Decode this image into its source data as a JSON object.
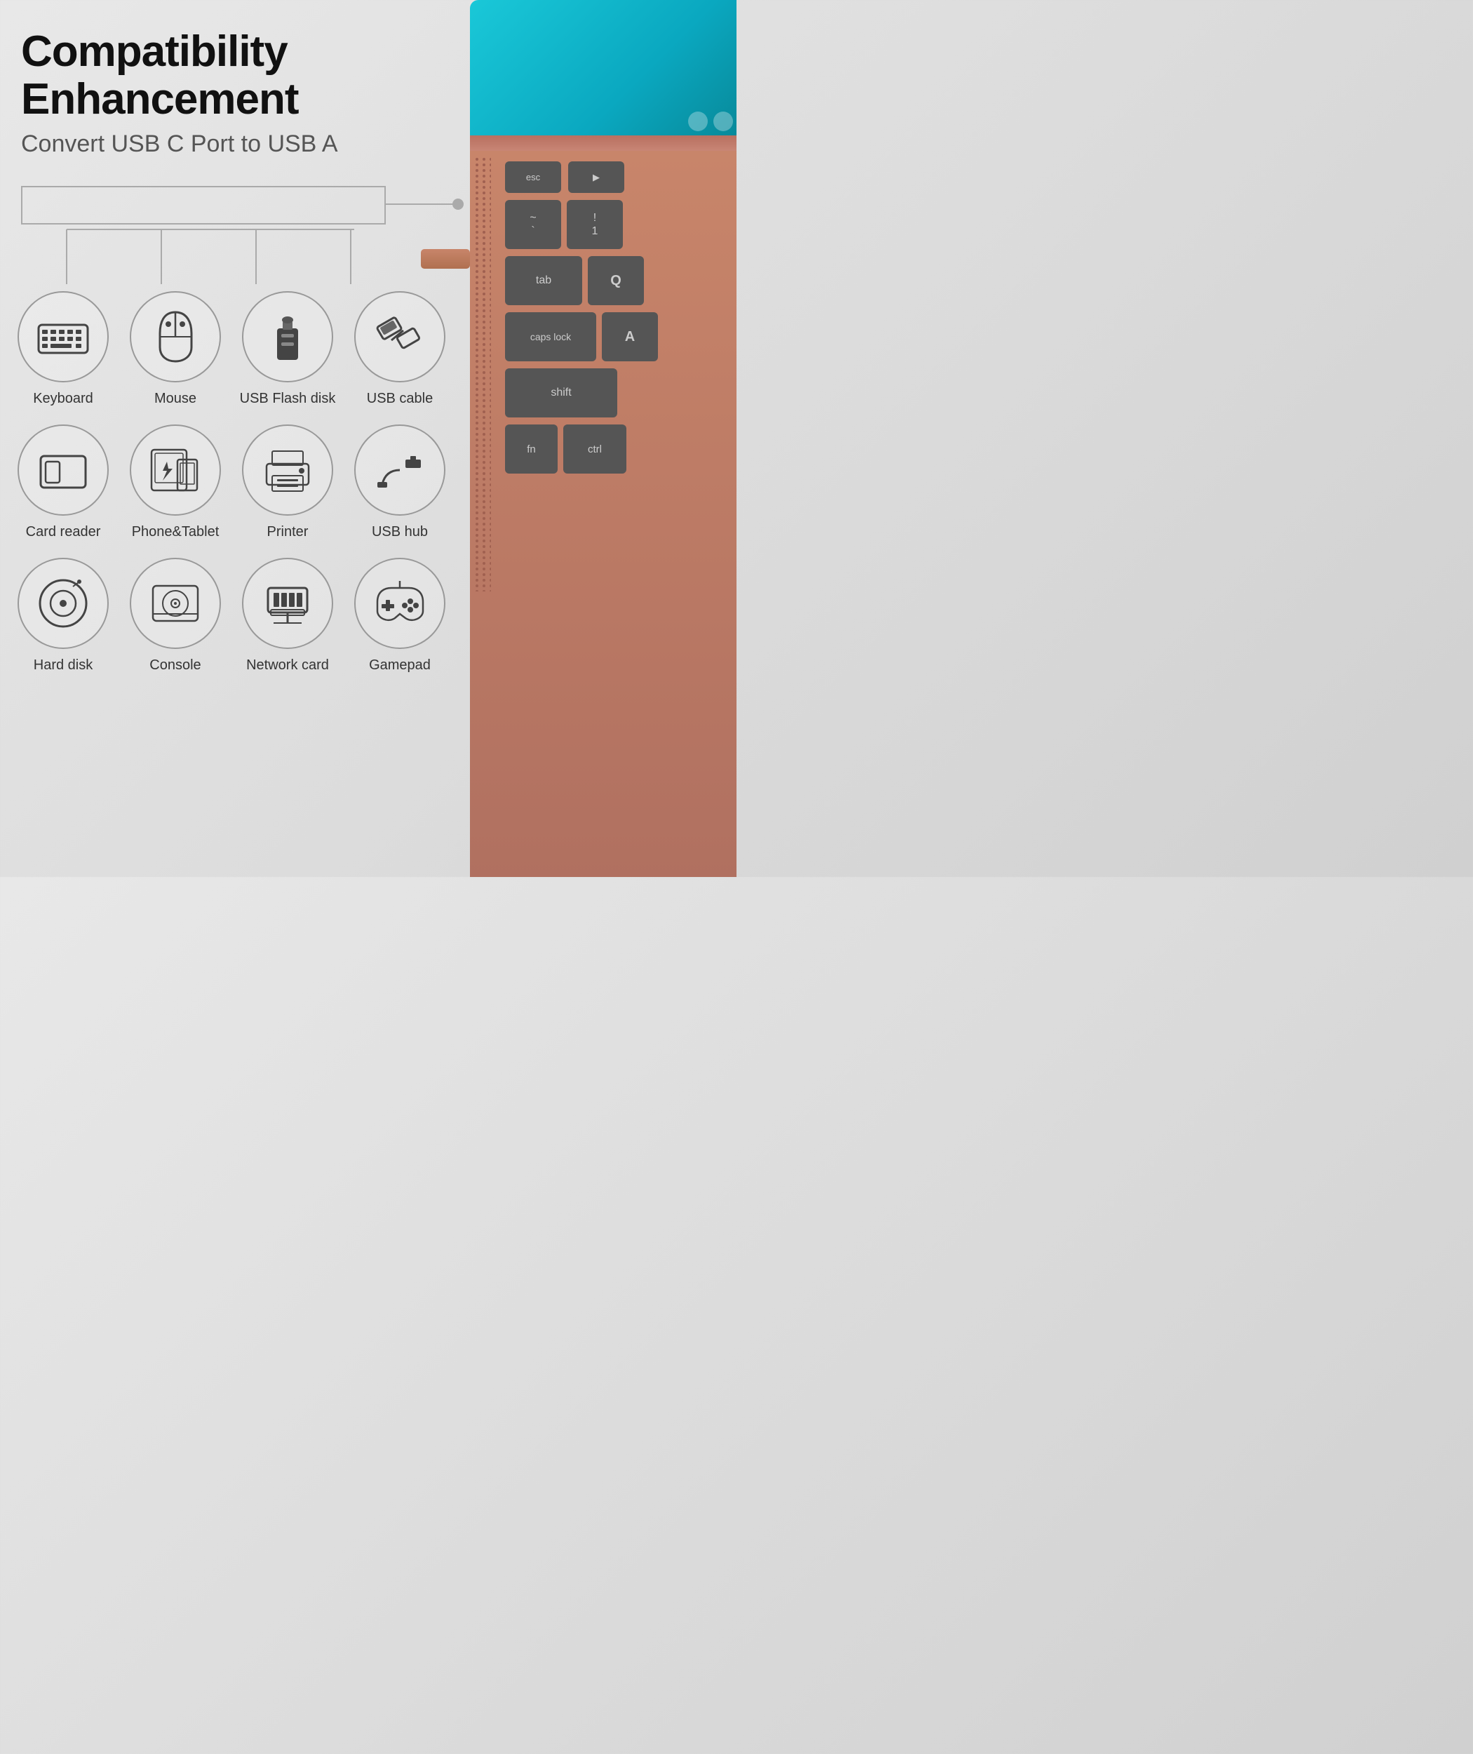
{
  "header": {
    "main_title": "Compatibility Enhancement",
    "subtitle": "Convert USB C Port to USB A"
  },
  "icons": [
    {
      "id": "keyboard",
      "label": "Keyboard",
      "type": "keyboard"
    },
    {
      "id": "mouse",
      "label": "Mouse",
      "type": "mouse"
    },
    {
      "id": "usb-flash",
      "label": "USB Flash disk",
      "type": "usb-flash"
    },
    {
      "id": "usb-cable",
      "label": "USB cable",
      "type": "usb-cable"
    },
    {
      "id": "card-reader",
      "label": "Card reader",
      "type": "card-reader"
    },
    {
      "id": "phone-tablet",
      "label": "Phone&Tablet",
      "type": "phone-tablet"
    },
    {
      "id": "printer",
      "label": "Printer",
      "type": "printer"
    },
    {
      "id": "usb-hub",
      "label": "USB hub",
      "type": "usb-hub"
    },
    {
      "id": "hard-disk",
      "label": "Hard disk",
      "type": "hard-disk"
    },
    {
      "id": "console",
      "label": "Console",
      "type": "console"
    },
    {
      "id": "network-card",
      "label": "Network card",
      "type": "network-card"
    },
    {
      "id": "gamepad",
      "label": "Gamepad",
      "type": "gamepad"
    }
  ],
  "keyboard_keys": {
    "row1": [
      "esc",
      "▶"
    ],
    "row2": [
      "`",
      "!",
      "1"
    ],
    "row3": [
      "tab",
      "Q"
    ],
    "row4": [
      "caps lock",
      "A"
    ],
    "row5": [
      "shift"
    ],
    "row6": [
      "fn",
      "ctrl"
    ]
  },
  "colors": {
    "title": "#111111",
    "subtitle": "#555555",
    "icon_stroke": "#888888",
    "icon_fill": "#444444",
    "background": "#d8d8d8",
    "laptop_rose": "#c8856a"
  }
}
